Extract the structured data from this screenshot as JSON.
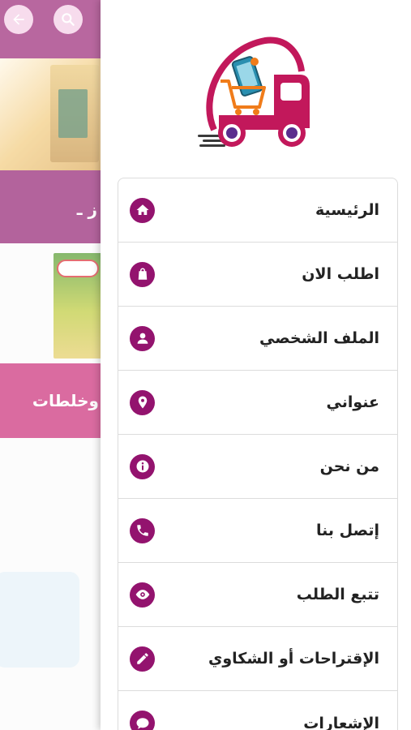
{
  "background": {
    "banner1_text": "ز ـ",
    "banner2_text": "وخلطات"
  },
  "drawer": {
    "menu": [
      {
        "label": "الرئيسية",
        "icon": "home-icon"
      },
      {
        "label": "اطلب الان",
        "icon": "shopping-bag-icon"
      },
      {
        "label": "الملف الشخصي",
        "icon": "user-icon"
      },
      {
        "label": "عنواني",
        "icon": "location-pin-icon"
      },
      {
        "label": "من نحن",
        "icon": "info-icon"
      },
      {
        "label": "إتصل بنا",
        "icon": "phone-icon"
      },
      {
        "label": "تتبع الطلب",
        "icon": "eye-icon"
      },
      {
        "label": "الإقتراحات أو الشكاوي",
        "icon": "pencil-icon"
      },
      {
        "label": "الإشعارات",
        "icon": "chat-bubble-icon"
      }
    ]
  },
  "colors": {
    "primary": "#93136e",
    "accent_pink": "#c71d6e",
    "header_button": "#f3c9e4"
  }
}
